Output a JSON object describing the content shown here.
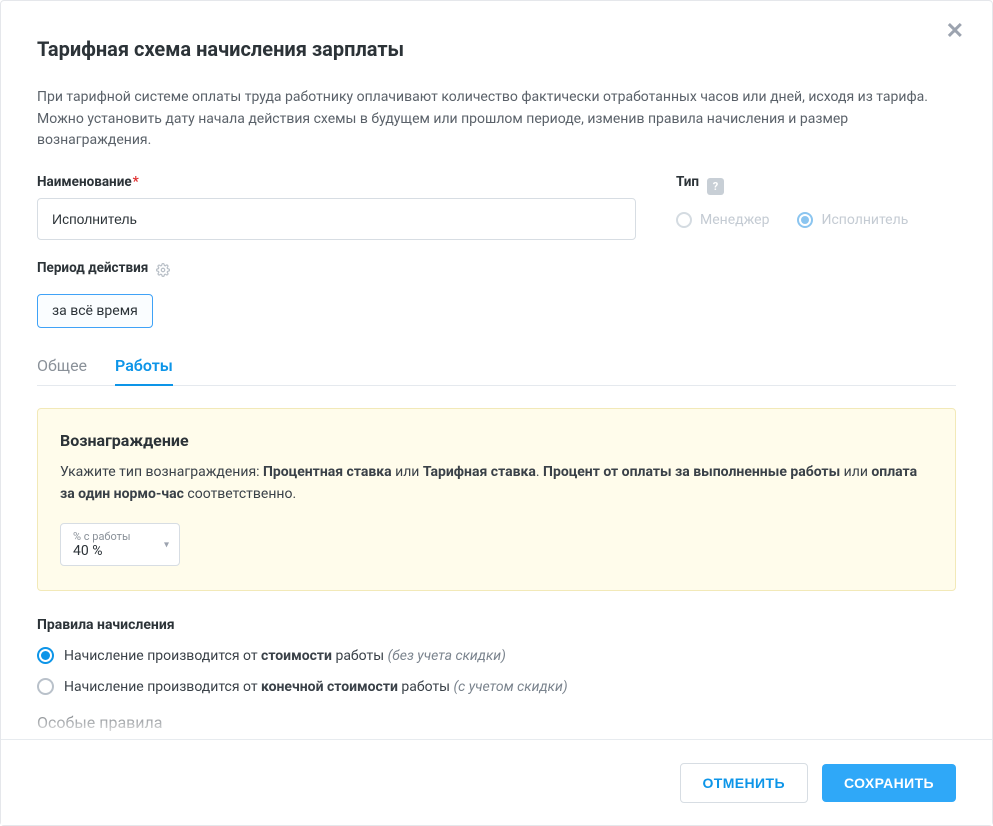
{
  "title": "Тарифная схема начисления зарплаты",
  "description": "При тарифной системе оплаты труда работнику оплачивают количество фактически отработанных часов или дней, исходя из тарифа. Можно установить дату начала действия схемы в будущем или прошлом периоде, изменив правила начисления и размер вознаграждения.",
  "name_field": {
    "label": "Наименование",
    "value": "Исполнитель"
  },
  "type_field": {
    "label": "Тип",
    "options": {
      "manager": "Менеджер",
      "executor": "Исполнитель"
    },
    "selected": "executor"
  },
  "period": {
    "label": "Период действия",
    "value": "за всё время"
  },
  "tabs": {
    "general": "Общее",
    "works": "Работы",
    "active": "works"
  },
  "reward": {
    "title": "Вознаграждение",
    "text_prefix": "Укажите тип вознаграждения: ",
    "text_b1": "Процентная ставка",
    "text_mid1": " или ",
    "text_b2": "Тарифная ставка",
    "text_mid2": ". ",
    "text_b3": "Процент от оплаты за выполненные работы",
    "text_mid3": " или ",
    "text_b4": "оплата за один нормо-час",
    "text_suffix": " соответственно.",
    "select_label": "% с работы",
    "select_value": "40 %"
  },
  "rules": {
    "title": "Правила начисления",
    "opt1_prefix": "Начисление производится от ",
    "opt1_bold": "стоимости",
    "opt1_mid": " работы ",
    "opt1_italic": "(без учета скидки)",
    "opt2_prefix": "Начисление производится от ",
    "opt2_bold": "конечной стоимости",
    "opt2_mid": " работы ",
    "opt2_italic": "(с учетом скидки)",
    "selected": 0
  },
  "special_rules_title": "Особые правила",
  "footer": {
    "cancel": "ОТМЕНИТЬ",
    "save": "СОХРАНИТЬ"
  }
}
